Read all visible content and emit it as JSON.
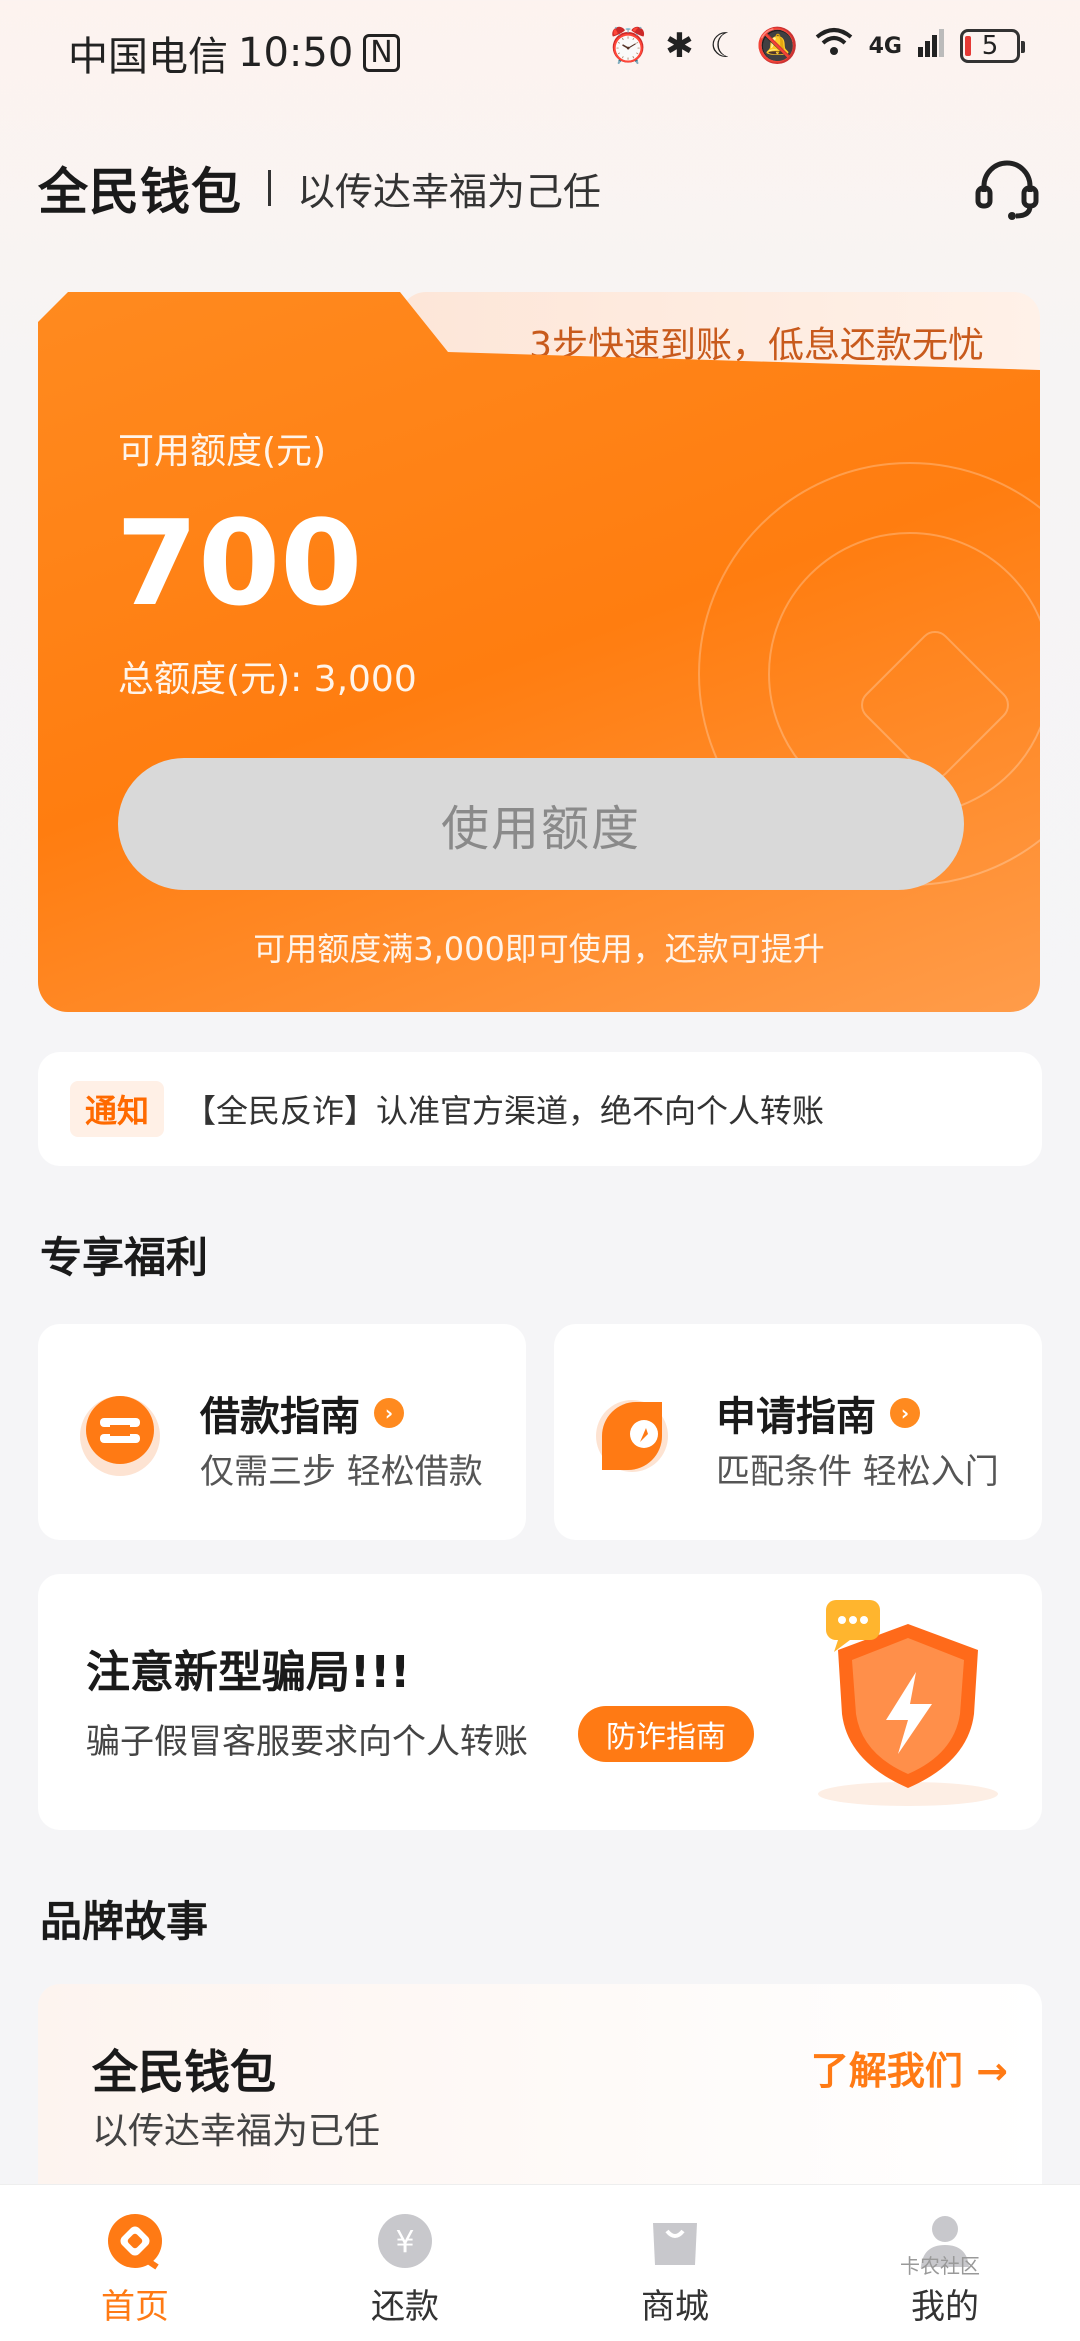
{
  "status_bar": {
    "carrier": "中国电信",
    "time": "10:50",
    "network": "4G",
    "battery": "5"
  },
  "header": {
    "brand": "全民钱包",
    "slogan": "以传达幸福为己任"
  },
  "credit_card": {
    "tab_text": "3步快速到账，低息还款无忧",
    "available_label": "可用额度(元)",
    "available_amount": "700",
    "total_label": "总额度(元): 3,000",
    "use_button": "使用额度",
    "hint": "可用额度满3,000即可使用，还款可提升"
  },
  "notice": {
    "tag": "通知",
    "text": "【全民反诈】认准官方渠道，绝不向个人转账"
  },
  "benefits": {
    "title": "专享福利",
    "items": [
      {
        "title": "借款指南",
        "subtitle": "仅需三步 轻松借款",
        "icon": "loan-guide-icon"
      },
      {
        "title": "申请指南",
        "subtitle": "匹配条件 轻松入门",
        "icon": "apply-guide-icon"
      }
    ]
  },
  "fraud_alert": {
    "title": "注意新型骗局!!!",
    "subtitle": "骗子假冒客服要求向个人转账",
    "button": "防诈指南"
  },
  "brand_story": {
    "section_title": "品牌故事",
    "title": "全民钱包",
    "subtitle": "以传达幸福为已任",
    "link": "了解我们 →"
  },
  "bottom_nav": {
    "items": [
      {
        "label": "首页",
        "active": true
      },
      {
        "label": "还款",
        "active": false
      },
      {
        "label": "商城",
        "active": false
      },
      {
        "label": "我的",
        "active": false
      }
    ]
  },
  "watermark": "卡农社区",
  "colors": {
    "accent": "#ff7a14",
    "card_orange": "#ff8a1f",
    "button_disabled": "#d9d9d9"
  }
}
